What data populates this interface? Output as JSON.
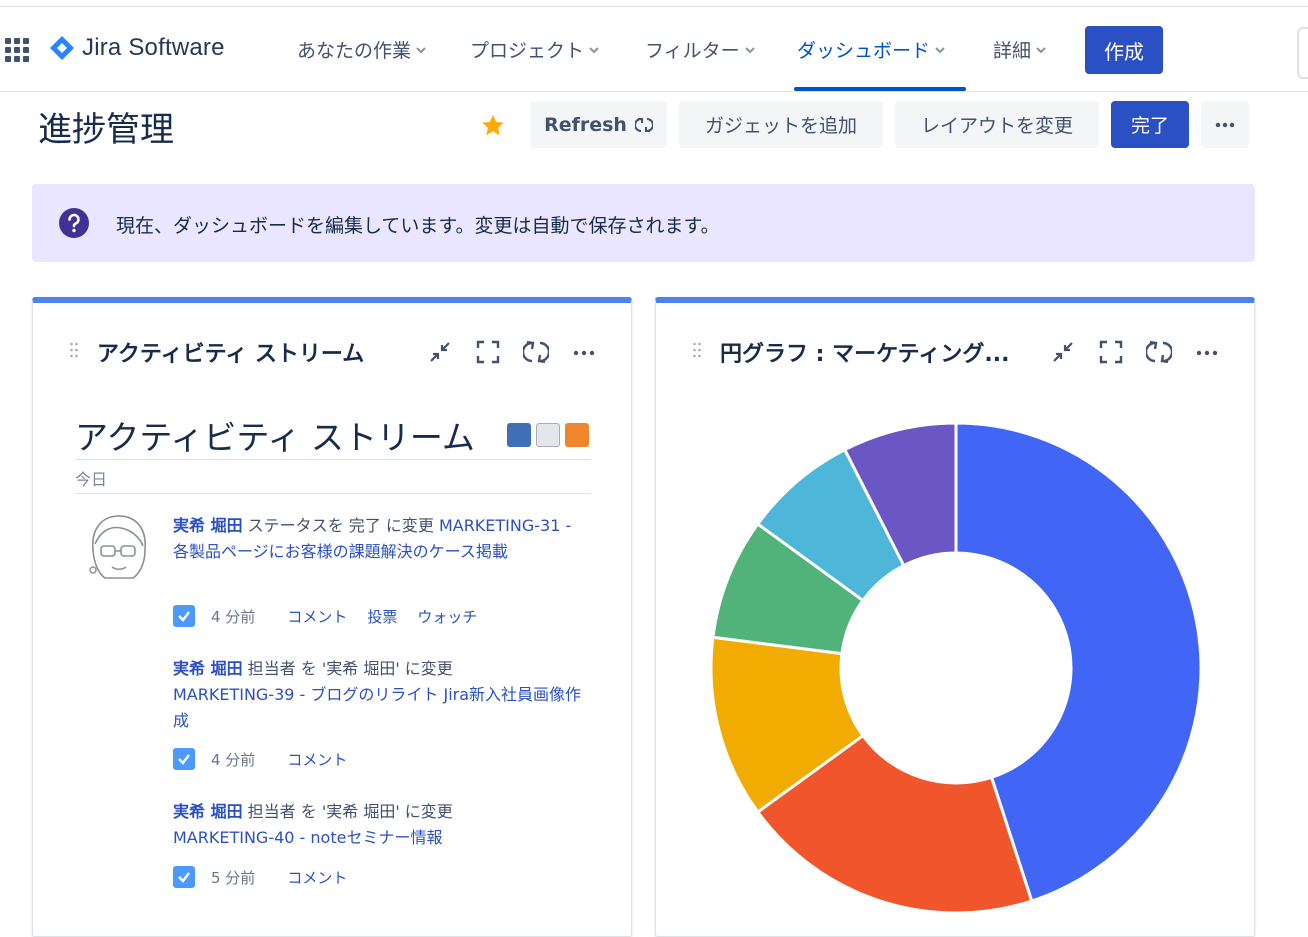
{
  "app": {
    "name": "Jira Software",
    "brand_color": "#2684ff"
  },
  "nav": {
    "items": [
      {
        "label": "あなたの作業",
        "active": false
      },
      {
        "label": "プロジェクト",
        "active": false
      },
      {
        "label": "フィルター",
        "active": false
      },
      {
        "label": "ダッシュボード",
        "active": true
      },
      {
        "label": "詳細",
        "active": false
      }
    ],
    "create_label": "作成"
  },
  "header": {
    "title": "進捗管理",
    "starred": true,
    "refresh_label": "Refresh",
    "add_gadget_label": "ガジェットを追加",
    "change_layout_label": "レイアウトを変更",
    "done_label": "完了",
    "more_icon": "more-icon"
  },
  "banner": {
    "message": "現在、ダッシュボードを編集しています。変更は自動で保存されます。",
    "icon": "question-icon"
  },
  "activity_gadget": {
    "title": "アクティビティ ストリーム",
    "heading": "アクティビティ ストリーム",
    "group_label": "今日",
    "entries": [
      {
        "user": "実希 堀田",
        "action": " ステータスを 完了 に変更 ",
        "link": "MARKETING-31 - 各製品ページにお客様の課題解決のケース掲載",
        "time": "4 分前",
        "actions": [
          "コメント",
          "投票",
          "ウォッチ"
        ]
      },
      {
        "user": "実希 堀田",
        "action": " 担当者 を '実希 堀田' に変更",
        "link": "MARKETING-39 - ブログのリライト Jira新入社員画像作成",
        "time": "4 分前",
        "actions": [
          "コメント"
        ]
      },
      {
        "user": "実希 堀田",
        "action": " 担当者 を '実希 堀田' に変更",
        "link": "MARKETING-40 - noteセミナー情報",
        "time": "5 分前",
        "actions": [
          "コメント"
        ]
      }
    ]
  },
  "pie_gadget": {
    "title": "円グラフ : マーケティング..."
  },
  "chart_data": {
    "type": "pie",
    "donut": true,
    "title": "",
    "slices": [
      {
        "value": 45,
        "color": "#4166f5"
      },
      {
        "value": 20,
        "color": "#f0552c"
      },
      {
        "value": 12,
        "color": "#f2ab00"
      },
      {
        "value": 8,
        "color": "#52b37a"
      },
      {
        "value": 7.5,
        "color": "#4eb6d9"
      },
      {
        "value": 7.5,
        "color": "#6b57c4"
      }
    ]
  }
}
